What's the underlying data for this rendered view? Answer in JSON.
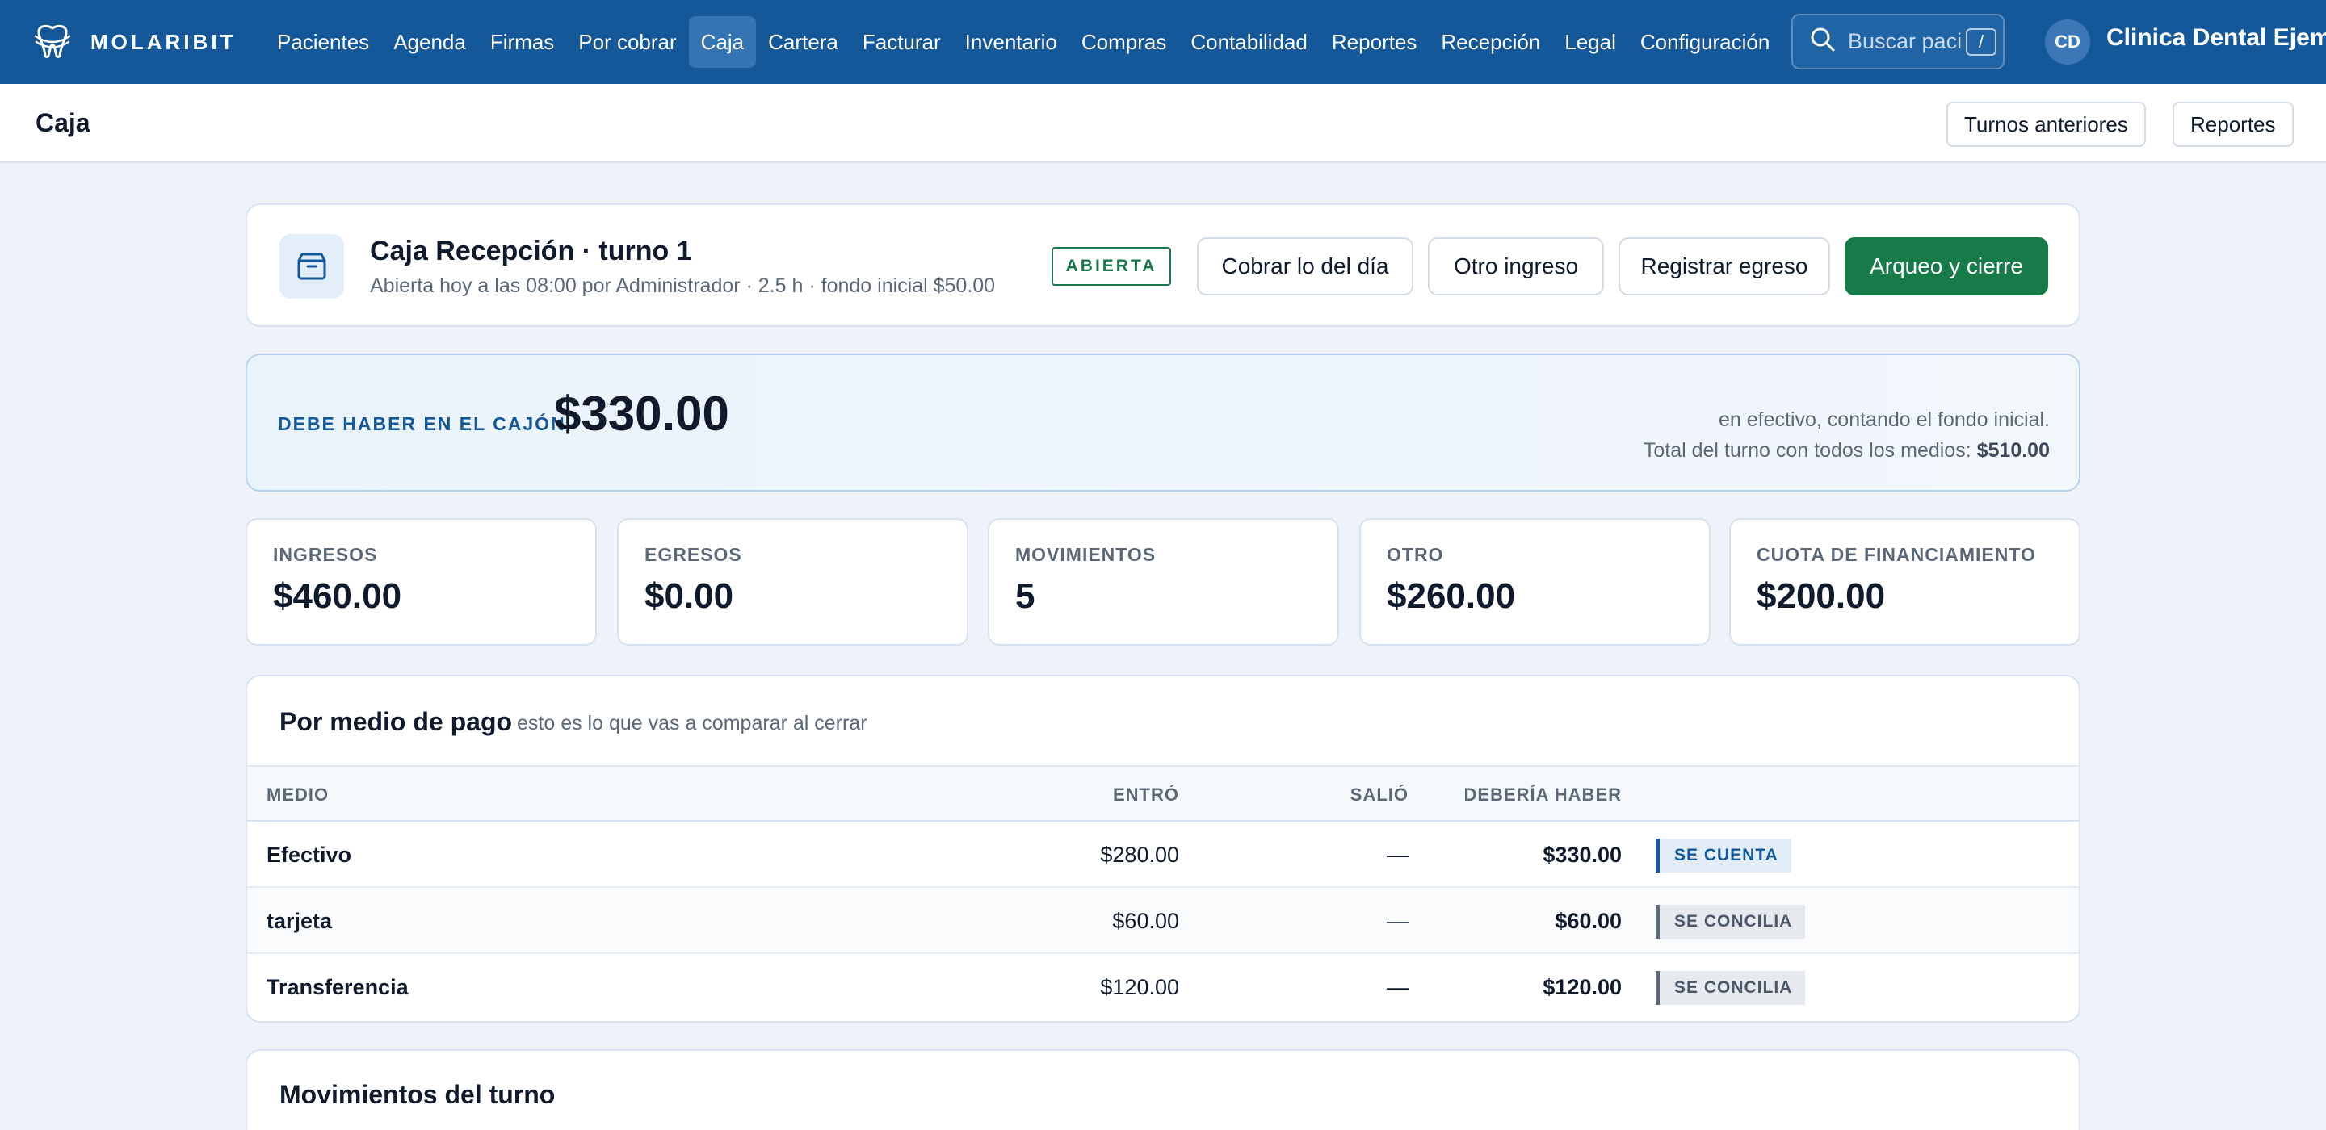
{
  "brand": {
    "name": "MOLARIBIT"
  },
  "nav": {
    "items": [
      {
        "label": "Pacientes"
      },
      {
        "label": "Agenda"
      },
      {
        "label": "Firmas"
      },
      {
        "label": "Por cobrar"
      },
      {
        "label": "Caja",
        "active": true
      },
      {
        "label": "Cartera"
      },
      {
        "label": "Facturar"
      },
      {
        "label": "Inventario"
      },
      {
        "label": "Compras"
      },
      {
        "label": "Contabilidad"
      },
      {
        "label": "Reportes"
      },
      {
        "label": "Recepción"
      },
      {
        "label": "Legal"
      },
      {
        "label": "Configuración"
      }
    ],
    "search": {
      "placeholder": "Buscar paci",
      "shortcut": "/"
    },
    "user": {
      "initials": "CD",
      "clinic": "Clinica Dental Ejemp"
    }
  },
  "page": {
    "title": "Caja",
    "buttons": {
      "previous_shifts": "Turnos anteriores",
      "reports": "Reportes"
    }
  },
  "shift": {
    "title": "Caja Recepción · turno 1",
    "subtitle": "Abierta hoy a las 08:00 por Administrador · 2.5 h · fondo inicial $50.00",
    "status": "ABIERTA",
    "actions": {
      "collect_day": "Cobrar lo del día",
      "other_income": "Otro ingreso",
      "register_expense": "Registrar egreso",
      "close": "Arqueo y cierre"
    }
  },
  "drawer": {
    "label": "DEBE HABER EN EL CAJÓN",
    "amount": "$330.00",
    "note": "en efectivo, contando el fondo inicial.",
    "total_prefix": "Total del turno con todos los medios:",
    "total_value": "$510.00"
  },
  "stats": [
    {
      "label": "INGRESOS",
      "value": "$460.00"
    },
    {
      "label": "EGRESOS",
      "value": "$0.00"
    },
    {
      "label": "MOVIMIENTOS",
      "value": "5"
    },
    {
      "label": "OTRO",
      "value": "$260.00"
    },
    {
      "label": "CUOTA DE FINANCIAMIENTO",
      "value": "$200.00"
    }
  ],
  "payments": {
    "title": "Por medio de pago",
    "subtitle": "esto es lo que vas a comparar al cerrar",
    "columns": {
      "medium": "MEDIO",
      "in": "ENTRÓ",
      "out": "SALIÓ",
      "expected": "DEBERÍA HABER"
    },
    "rows": [
      {
        "medium": "Efectivo",
        "in": "$280.00",
        "out": "—",
        "expected": "$330.00",
        "tag": "SE CUENTA"
      },
      {
        "medium": "tarjeta",
        "in": "$60.00",
        "out": "—",
        "expected": "$60.00",
        "tag": "SE CONCILIA"
      },
      {
        "medium": "Transferencia",
        "in": "$120.00",
        "out": "—",
        "expected": "$120.00",
        "tag": "SE CONCILIA"
      }
    ]
  },
  "movements": {
    "title": "Movimientos del turno"
  },
  "colors": {
    "nav_bg": "#14589a",
    "primary_green": "#167a49",
    "accent_blue": "#14589a",
    "page_bg": "#eef3f9"
  }
}
